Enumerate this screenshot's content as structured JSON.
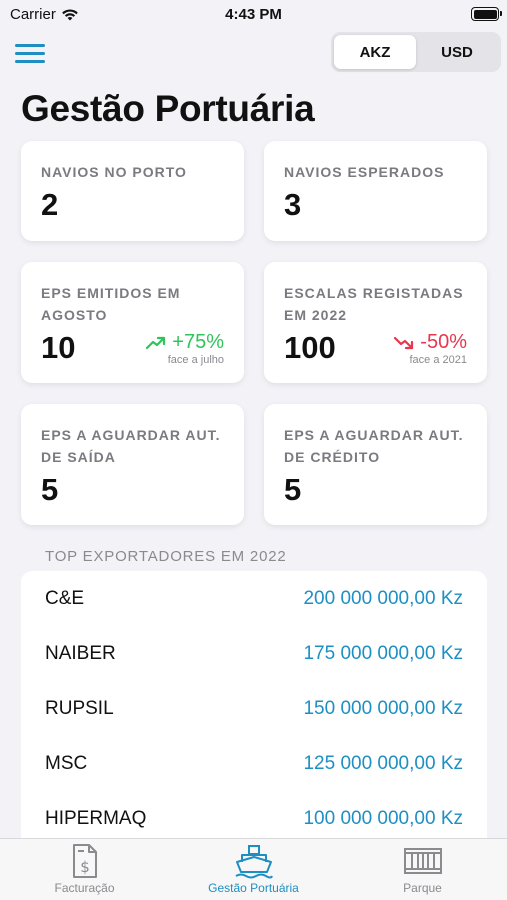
{
  "status_bar": {
    "carrier": "Carrier",
    "time": "4:43 PM"
  },
  "currency": {
    "options": [
      "AKZ",
      "USD"
    ],
    "selected": "AKZ"
  },
  "page_title": "Gestão Portuária",
  "cards": [
    {
      "label": "NAVIOS NO PORTO",
      "value": "2"
    },
    {
      "label": "NAVIOS ESPERADOS",
      "value": "3"
    },
    {
      "label": "EPs EMITIDOS EM AGOSTO",
      "value": "10",
      "trend": "+75%",
      "trend_note": "face a julho",
      "trend_direction": "up"
    },
    {
      "label": "ESCALAS REGISTADAS EM 2022",
      "value": "100",
      "trend": "-50%",
      "trend_note": "face a 2021",
      "trend_direction": "down"
    },
    {
      "label": "EPs A AGUARDAR AUT. DE SAÍDA",
      "value": "5"
    },
    {
      "label": "EPs A AGUARDAR AUT. DE CRÉDITO",
      "value": "5"
    }
  ],
  "exporters": {
    "title": "TOP EXPORTADORES EM 2022",
    "rows": [
      {
        "name": "C&E",
        "amount": "200 000 000,00 Kz"
      },
      {
        "name": "NAIBER",
        "amount": "175 000 000,00 Kz"
      },
      {
        "name": "RUPSIL",
        "amount": "150 000 000,00 Kz"
      },
      {
        "name": "MSC",
        "amount": "125 000 000,00 Kz"
      },
      {
        "name": "HIPERMAQ",
        "amount": "100 000 000,00 Kz"
      }
    ]
  },
  "tabs": [
    {
      "label": "Facturação",
      "icon": "invoice-icon",
      "active": false
    },
    {
      "label": "Gestão Portuária",
      "icon": "ship-icon",
      "active": true
    },
    {
      "label": "Parque",
      "icon": "container-icon",
      "active": false
    }
  ],
  "colors": {
    "accent": "#1e8fc3",
    "up": "#2fc45b",
    "down": "#e8364f"
  }
}
